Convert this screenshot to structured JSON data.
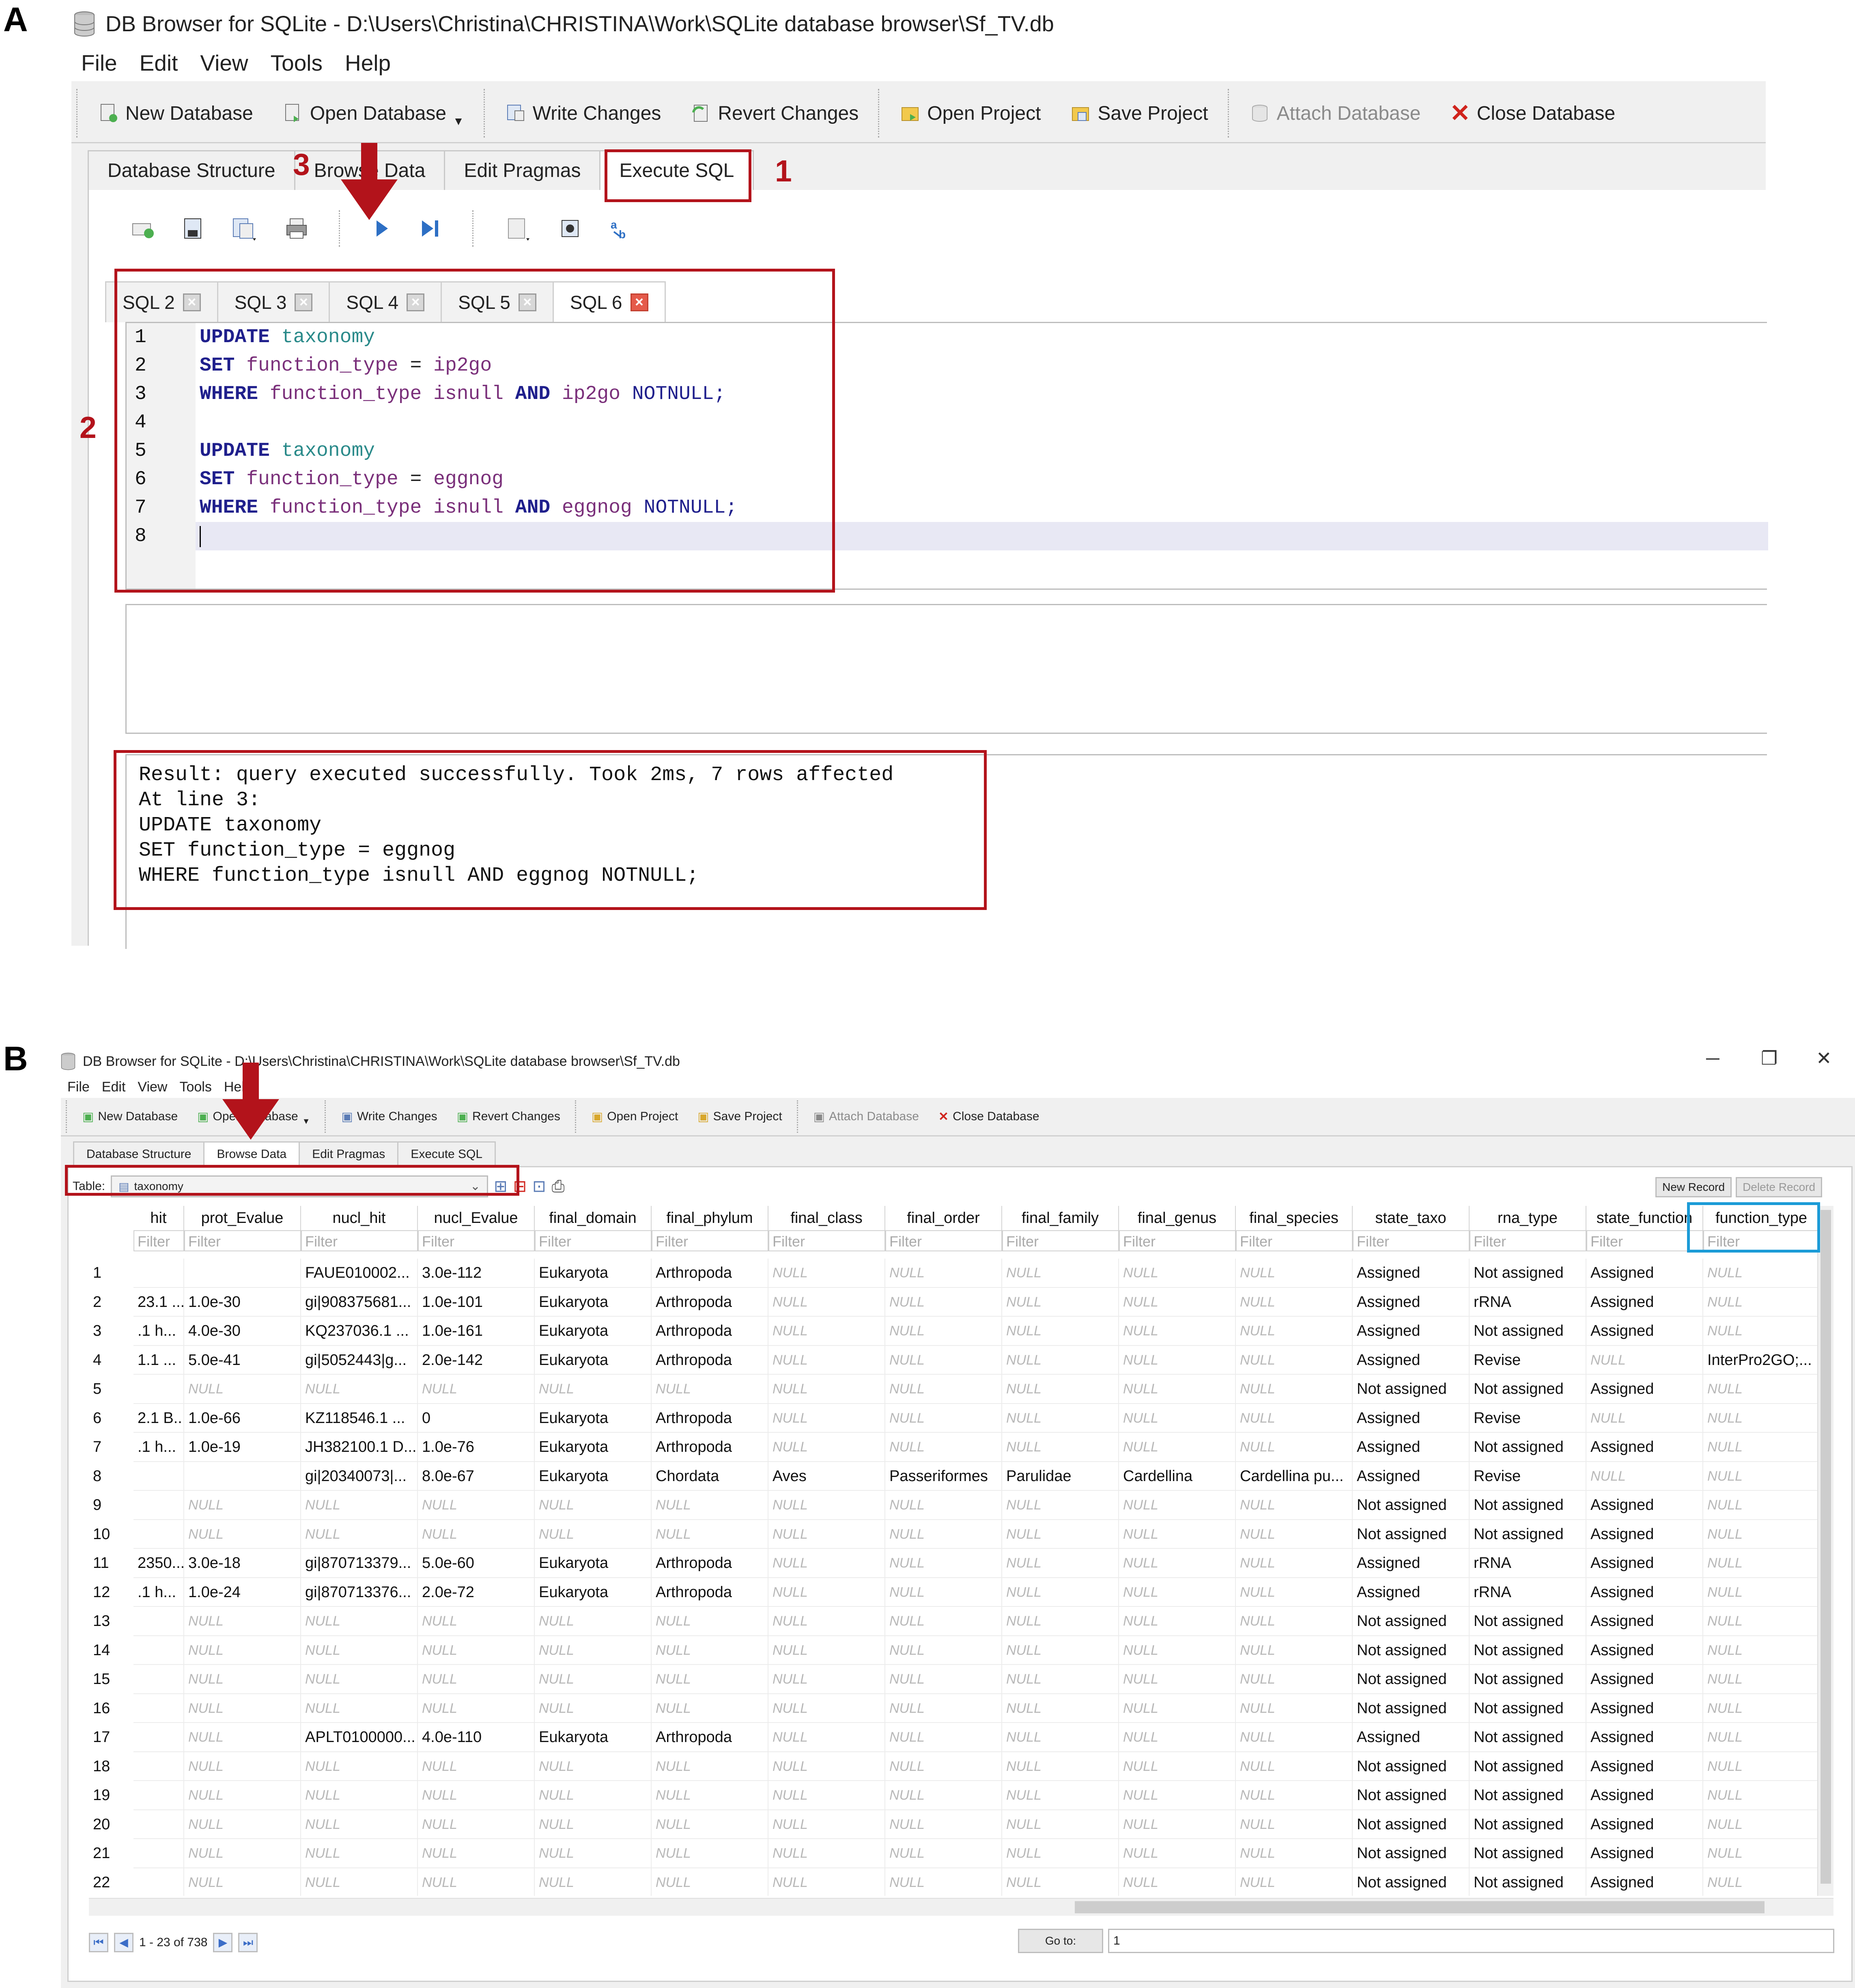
{
  "panels": {
    "a": "A",
    "b": "B"
  },
  "panel_a": {
    "title": "DB Browser for SQLite - D:\\Users\\Christina\\CHRISTINA\\Work\\SQLite database browser\\Sf_TV.db",
    "menu": [
      "File",
      "Edit",
      "View",
      "Tools",
      "Help"
    ],
    "toolbar": {
      "new_db": "New Database",
      "open_db": "Open Database",
      "write": "Write Changes",
      "revert": "Revert Changes",
      "open_proj": "Open Project",
      "save_proj": "Save Project",
      "attach": "Attach Database",
      "close": "Close Database"
    },
    "tabs": [
      "Database Structure",
      "Browse Data",
      "Edit Pragmas",
      "Execute SQL"
    ],
    "sql_tabs": [
      "SQL 2",
      "SQL 3",
      "SQL 4",
      "SQL 5",
      "SQL 6"
    ],
    "line_numbers": [
      "1",
      "2",
      "3",
      "4",
      "5",
      "6",
      "7",
      "8"
    ],
    "code": {
      "l1": {
        "kw": "UPDATE",
        "tbl": "taxonomy"
      },
      "l2": {
        "kw": "SET",
        "fld": "function_type",
        "op": "=",
        "val": "ip2go"
      },
      "l3": {
        "kw": "WHERE",
        "fld": "function_type",
        "fn": "isnull",
        "and": "AND",
        "val": "ip2go",
        "nn": "NOTNULL;"
      },
      "l5": {
        "kw": "UPDATE",
        "tbl": "taxonomy"
      },
      "l6": {
        "kw": "SET",
        "fld": "function_type",
        "op": "=",
        "val": "eggnog"
      },
      "l7": {
        "kw": "WHERE",
        "fld": "function_type",
        "fn": "isnull",
        "and": "AND",
        "val": "eggnog",
        "nn": "NOTNULL;"
      }
    },
    "messages": [
      "Result: query executed successfully. Took 2ms, 7 rows affected",
      "At line 3:",
      "UPDATE taxonomy",
      "SET function_type = eggnog",
      "WHERE function_type isnull AND eggnog NOTNULL;"
    ],
    "annotations": {
      "one": "1",
      "two": "2",
      "three": "3"
    }
  },
  "panel_b": {
    "title": "DB Browser for SQLite - D:\\Users\\Christina\\CHRISTINA\\Work\\SQLite database browser\\Sf_TV.db",
    "menu": [
      "File",
      "Edit",
      "View",
      "Tools",
      "Help"
    ],
    "window_controls": {
      "min": "─",
      "max": "❐",
      "close": "✕"
    },
    "toolbar": {
      "new_db": "New Database",
      "open_db": "Open Database",
      "write": "Write Changes",
      "revert": "Revert Changes",
      "open_proj": "Open Project",
      "save_proj": "Save Project",
      "attach": "Attach Database",
      "close": "Close Database"
    },
    "tabs": [
      "Database Structure",
      "Browse Data",
      "Edit Pragmas",
      "Execute SQL"
    ],
    "table_label": "Table:",
    "table_name": "taxonomy",
    "new_record": "New Record",
    "delete_record": "Delete Record",
    "filter_placeholder": "Filter",
    "columns": [
      "hit",
      "prot_Evalue",
      "nucl_hit",
      "nucl_Evalue",
      "final_domain",
      "final_phylum",
      "final_class",
      "final_order",
      "final_family",
      "final_genus",
      "final_species",
      "state_taxo",
      "rna_type",
      "state_function",
      "function_type"
    ],
    "rows": [
      [
        "1",
        "",
        "",
        "FAUE010002...",
        "3.0e-112",
        "Eukaryota",
        "Arthropoda",
        "NULL",
        "NULL",
        "NULL",
        "NULL",
        "NULL",
        "Assigned",
        "Not assigned",
        "Assigned",
        "NULL"
      ],
      [
        "2",
        "23.1 ...",
        "1.0e-30",
        "gi|908375681...",
        "1.0e-101",
        "Eukaryota",
        "Arthropoda",
        "NULL",
        "NULL",
        "NULL",
        "NULL",
        "NULL",
        "Assigned",
        "rRNA",
        "Assigned",
        "NULL"
      ],
      [
        "3",
        ".1 h...",
        "4.0e-30",
        "KQ237036.1 ...",
        "1.0e-161",
        "Eukaryota",
        "Arthropoda",
        "NULL",
        "NULL",
        "NULL",
        "NULL",
        "NULL",
        "Assigned",
        "Not assigned",
        "Assigned",
        "NULL"
      ],
      [
        "4",
        "1.1 ...",
        "5.0e-41",
        "gi|5052443|g...",
        "2.0e-142",
        "Eukaryota",
        "Arthropoda",
        "NULL",
        "NULL",
        "NULL",
        "NULL",
        "NULL",
        "Assigned",
        "Revise",
        "NULL",
        "InterPro2GO;..."
      ],
      [
        "5",
        "",
        "NULL",
        "NULL",
        "NULL",
        "NULL",
        "NULL",
        "NULL",
        "NULL",
        "NULL",
        "NULL",
        "NULL",
        "Not assigned",
        "Not assigned",
        "Assigned",
        "NULL"
      ],
      [
        "6",
        "2.1 B...",
        "1.0e-66",
        "KZ118546.1 ...",
        "0",
        "Eukaryota",
        "Arthropoda",
        "NULL",
        "NULL",
        "NULL",
        "NULL",
        "NULL",
        "Assigned",
        "Revise",
        "NULL",
        "NULL"
      ],
      [
        "7",
        ".1 h...",
        "1.0e-19",
        "JH382100.1 D...",
        "1.0e-76",
        "Eukaryota",
        "Arthropoda",
        "NULL",
        "NULL",
        "NULL",
        "NULL",
        "NULL",
        "Assigned",
        "Not assigned",
        "Assigned",
        "NULL"
      ],
      [
        "8",
        "",
        "",
        "gi|20340073|...",
        "8.0e-67",
        "Eukaryota",
        "Chordata",
        "Aves",
        "Passeriformes",
        "Parulidae",
        "Cardellina",
        "Cardellina pu...",
        "Assigned",
        "Revise",
        "NULL",
        "NULL"
      ],
      [
        "9",
        "",
        "NULL",
        "NULL",
        "NULL",
        "NULL",
        "NULL",
        "NULL",
        "NULL",
        "NULL",
        "NULL",
        "NULL",
        "Not assigned",
        "Not assigned",
        "Assigned",
        "NULL"
      ],
      [
        "10",
        "",
        "NULL",
        "NULL",
        "NULL",
        "NULL",
        "NULL",
        "NULL",
        "NULL",
        "NULL",
        "NULL",
        "NULL",
        "Not assigned",
        "Not assigned",
        "Assigned",
        "NULL"
      ],
      [
        "11",
        "2350...",
        "3.0e-18",
        "gi|870713379...",
        "5.0e-60",
        "Eukaryota",
        "Arthropoda",
        "NULL",
        "NULL",
        "NULL",
        "NULL",
        "NULL",
        "Assigned",
        "rRNA",
        "Assigned",
        "NULL"
      ],
      [
        "12",
        ".1 h...",
        "1.0e-24",
        "gi|870713376...",
        "2.0e-72",
        "Eukaryota",
        "Arthropoda",
        "NULL",
        "NULL",
        "NULL",
        "NULL",
        "NULL",
        "Assigned",
        "rRNA",
        "Assigned",
        "NULL"
      ],
      [
        "13",
        "",
        "NULL",
        "NULL",
        "NULL",
        "NULL",
        "NULL",
        "NULL",
        "NULL",
        "NULL",
        "NULL",
        "NULL",
        "Not assigned",
        "Not assigned",
        "Assigned",
        "NULL"
      ],
      [
        "14",
        "",
        "NULL",
        "NULL",
        "NULL",
        "NULL",
        "NULL",
        "NULL",
        "NULL",
        "NULL",
        "NULL",
        "NULL",
        "Not assigned",
        "Not assigned",
        "Assigned",
        "NULL"
      ],
      [
        "15",
        "",
        "NULL",
        "NULL",
        "NULL",
        "NULL",
        "NULL",
        "NULL",
        "NULL",
        "NULL",
        "NULL",
        "NULL",
        "Not assigned",
        "Not assigned",
        "Assigned",
        "NULL"
      ],
      [
        "16",
        "",
        "NULL",
        "NULL",
        "NULL",
        "NULL",
        "NULL",
        "NULL",
        "NULL",
        "NULL",
        "NULL",
        "NULL",
        "Not assigned",
        "Not assigned",
        "Assigned",
        "NULL"
      ],
      [
        "17",
        "",
        "NULL",
        "APLT0100000...",
        "4.0e-110",
        "Eukaryota",
        "Arthropoda",
        "NULL",
        "NULL",
        "NULL",
        "NULL",
        "NULL",
        "Assigned",
        "Not assigned",
        "Assigned",
        "NULL"
      ],
      [
        "18",
        "",
        "NULL",
        "NULL",
        "NULL",
        "NULL",
        "NULL",
        "NULL",
        "NULL",
        "NULL",
        "NULL",
        "NULL",
        "Not assigned",
        "Not assigned",
        "Assigned",
        "NULL"
      ],
      [
        "19",
        "",
        "NULL",
        "NULL",
        "NULL",
        "NULL",
        "NULL",
        "NULL",
        "NULL",
        "NULL",
        "NULL",
        "NULL",
        "Not assigned",
        "Not assigned",
        "Assigned",
        "NULL"
      ],
      [
        "20",
        "",
        "NULL",
        "NULL",
        "NULL",
        "NULL",
        "NULL",
        "NULL",
        "NULL",
        "NULL",
        "NULL",
        "NULL",
        "Not assigned",
        "Not assigned",
        "Assigned",
        "NULL"
      ],
      [
        "21",
        "",
        "NULL",
        "NULL",
        "NULL",
        "NULL",
        "NULL",
        "NULL",
        "NULL",
        "NULL",
        "NULL",
        "NULL",
        "Not assigned",
        "Not assigned",
        "Assigned",
        "NULL"
      ],
      [
        "22",
        "",
        "NULL",
        "NULL",
        "NULL",
        "NULL",
        "NULL",
        "NULL",
        "NULL",
        "NULL",
        "NULL",
        "NULL",
        "Not assigned",
        "Not assigned",
        "Assigned",
        "NULL"
      ]
    ],
    "nav_label": "1 - 23 of 738",
    "goto_label": "Go to:",
    "goto_value": "1"
  },
  "colors": {
    "annotation_red": "#b3131b",
    "annotation_blue": "#1b9bd7",
    "keyword": "#1f1f8c",
    "table": "#2a8a8a"
  }
}
